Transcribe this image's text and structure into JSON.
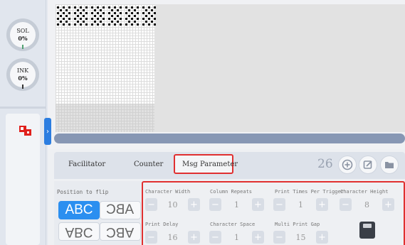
{
  "gauges": [
    {
      "label": "SOL",
      "value": "0%"
    },
    {
      "label": "INK",
      "value": "0%"
    }
  ],
  "icons": {
    "flip": "flip-tool-icon",
    "expand": "chevron-right-icon",
    "add": "plus-circle-icon",
    "edit": "edit-icon",
    "open": "folder-icon",
    "save": "save-icon"
  },
  "preview": {
    "expand_glyph": "›"
  },
  "tabs": {
    "facilitator": "Facilitator",
    "counter": "Counter",
    "msg_parameter": "Msg Parameter",
    "active": "Msg Parameter"
  },
  "toolbar": {
    "count": "26"
  },
  "flip": {
    "label": "Position to flip",
    "options": [
      "ABC",
      "ABC",
      "ABC",
      "ABC"
    ],
    "selected": "ABC"
  },
  "params": {
    "character_width": {
      "label": "Character Width",
      "value": "10"
    },
    "column_repeats": {
      "label": "Column Repeats",
      "value": "1"
    },
    "print_times_per_trigger": {
      "label": "Print Times Per Trigger",
      "value": "1"
    },
    "character_height": {
      "label": "Character Height",
      "value": "8"
    },
    "print_delay": {
      "label": "Print Delay",
      "value": "16"
    },
    "character_space": {
      "label": "Character Space",
      "value": "1"
    },
    "multi_print_gap": {
      "label": "Multi Print Gap",
      "value": "15"
    },
    "minus_glyph": "−",
    "plus_glyph": "+"
  },
  "colors": {
    "accent": "#2b8ff0",
    "highlight_border": "#e03030",
    "scrollbar": "#8797b4"
  }
}
